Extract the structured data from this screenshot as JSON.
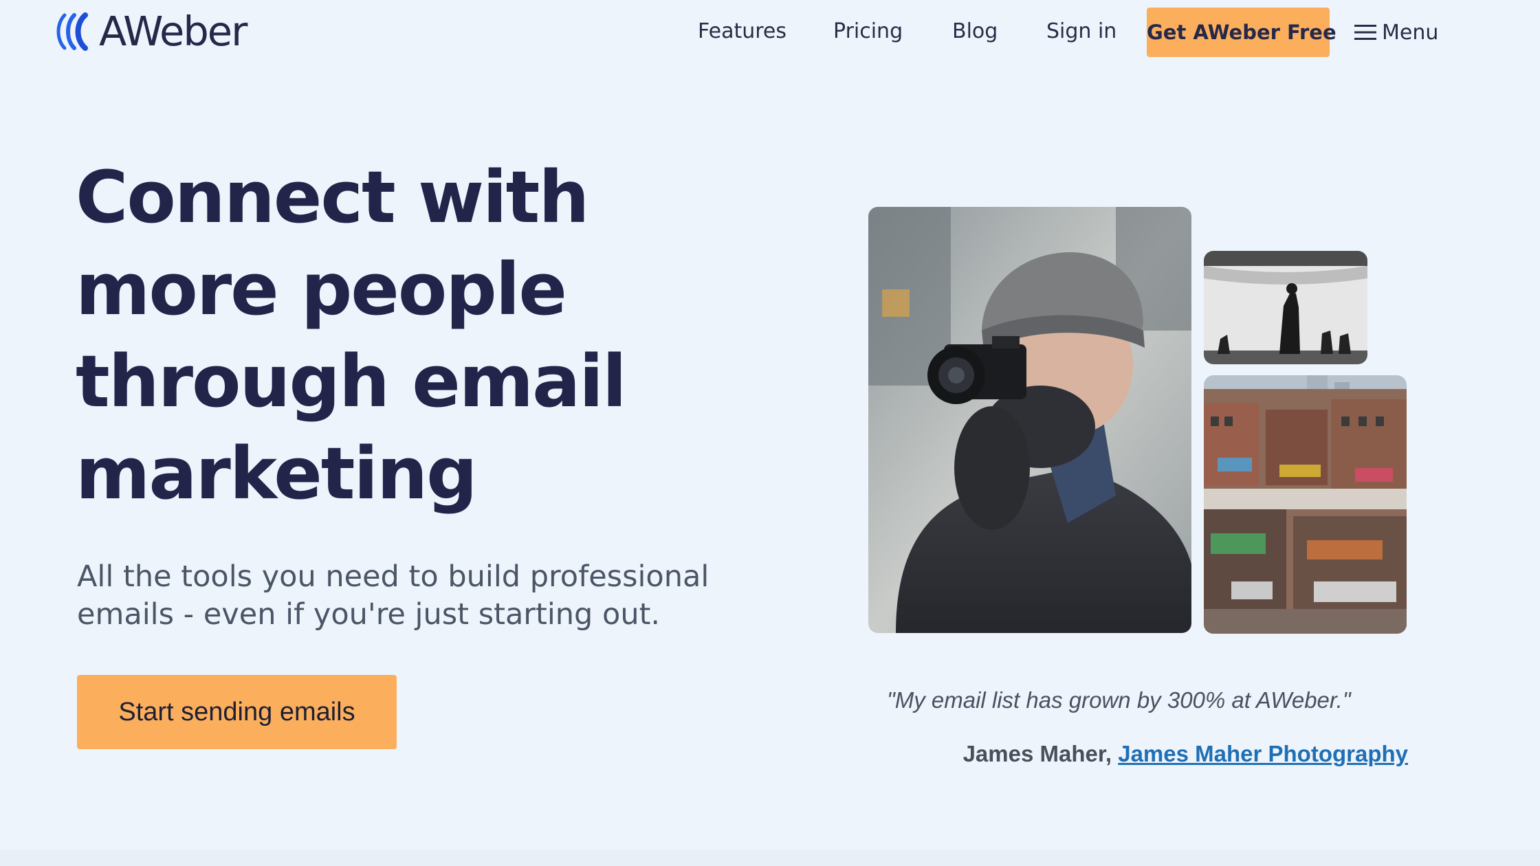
{
  "header": {
    "logo_text": "AWeber",
    "nav": [
      {
        "label": "Features"
      },
      {
        "label": "Pricing"
      },
      {
        "label": "Blog"
      },
      {
        "label": "Sign in"
      }
    ],
    "cta_label": "Get AWeber Free",
    "menu_label": "Menu",
    "menu_icon": "hamburger-icon"
  },
  "hero": {
    "headline_lines": [
      "Connect with",
      "more people",
      "through email",
      "marketing"
    ],
    "subhead_lines": [
      "All the tools you need to build professional",
      "emails - even if you're just starting out."
    ],
    "cta_label": "Start sending emails"
  },
  "testimonial": {
    "quote": "\"My email list has grown by 300% at AWeber.\"",
    "author": "James Maher,",
    "link_text": "James Maher Photography"
  },
  "colors": {
    "background": "#eef4fb",
    "accent_orange": "#fbae5c",
    "text_dark": "#23244a",
    "link_blue": "#1f6fb5",
    "logo_blue": "#2563eb"
  }
}
